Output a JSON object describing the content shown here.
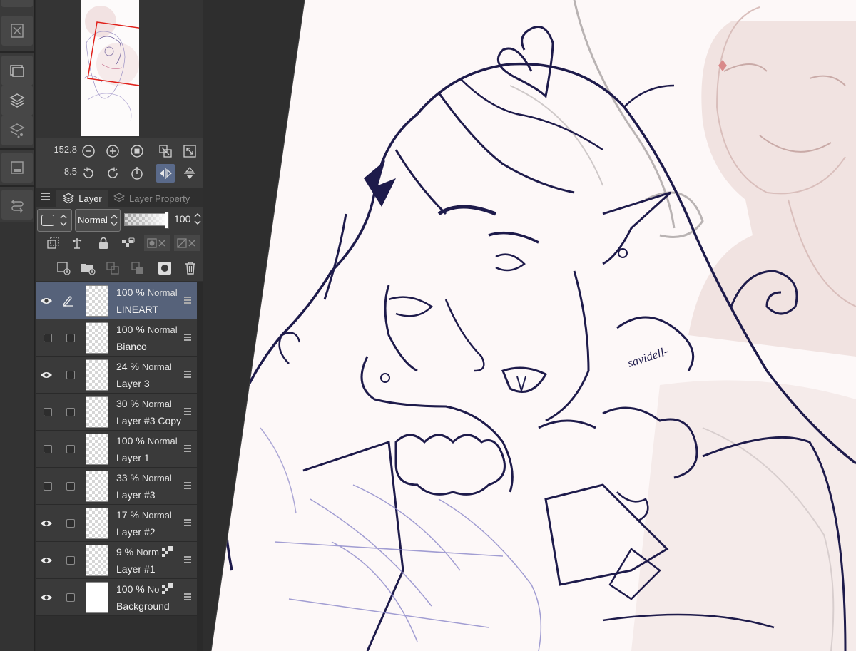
{
  "toolstrip": {
    "icons": [
      "close-doc-icon",
      "sub-view-icon",
      "layers-icon",
      "layer-property-icon",
      "material-icon",
      "history-icon"
    ]
  },
  "navigator": {
    "zoom_value": "152.8",
    "rotate_value": "8.5",
    "buttons": [
      "zoom-out-icon",
      "zoom-in-icon",
      "reset-zoom-icon",
      "fit-icon",
      "fullscreen-icon",
      "rotate-left-icon",
      "rotate-right-icon",
      "reset-rotation-icon",
      "flip-horizontal-icon",
      "flip-vertical-icon"
    ]
  },
  "tabs": {
    "layer_label": "Layer",
    "layer_property_label": "Layer Property"
  },
  "layer_controls": {
    "blend_mode": "Normal",
    "opacity_value": "100"
  },
  "layers": [
    {
      "opacity": "100 %",
      "mode": "Normal",
      "name": "LINEART",
      "visible": true,
      "selected": true,
      "editable": true
    },
    {
      "opacity": "100 %",
      "mode": "Normal",
      "name": "Bianco",
      "visible": false,
      "selected": false
    },
    {
      "opacity": "24 %",
      "mode": "Normal",
      "name": "Layer 3",
      "visible": true,
      "selected": false
    },
    {
      "opacity": "30 %",
      "mode": "Normal",
      "name": "Layer #3 Copy",
      "visible": false,
      "selected": false
    },
    {
      "opacity": "100 %",
      "mode": "Normal",
      "name": "Layer 1",
      "visible": false,
      "selected": false
    },
    {
      "opacity": "33 %",
      "mode": "Normal",
      "name": "Layer #3",
      "visible": false,
      "selected": false
    },
    {
      "opacity": "17 %",
      "mode": "Normal",
      "name": "Layer #2",
      "visible": true,
      "selected": false
    },
    {
      "opacity": "9 %",
      "mode": "Norm",
      "name": "Layer #1",
      "visible": true,
      "selected": false,
      "locked": true
    },
    {
      "opacity": "100 %",
      "mode": "No",
      "name": "Background",
      "visible": true,
      "selected": false,
      "locked": true
    }
  ],
  "canvas": {
    "signature": "savidell-",
    "colors": {
      "line": "#1e1b4b",
      "bg": "#fdf8f8",
      "pink": "#ecd6d4",
      "blue_sketch": "#8a86c8"
    }
  }
}
